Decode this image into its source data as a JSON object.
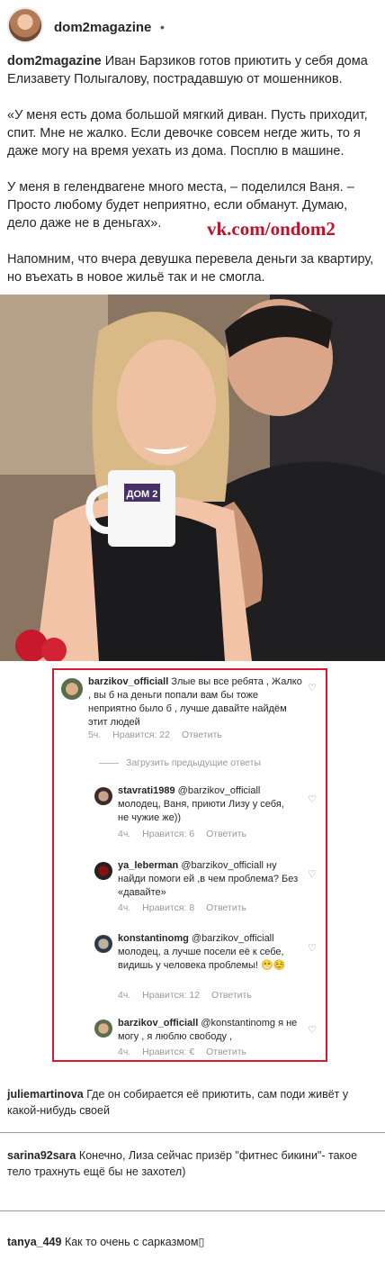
{
  "post": {
    "username": "dom2magazine",
    "dot": "•",
    "caption_user": "dom2magazine",
    "caption_p1": " Иван Барзиков готов приютить у себя дома Елизавету Полыгалову, пострадавшую от мошенников.",
    "caption_p2": "«У меня есть дома большой мягкий диван. Пусть приходит, спит. Мне не жалко. Если девочке совсем негде жить, то я даже могу на время уехать из дома. Посплю в машине.",
    "caption_p3": "У меня в гелендвагене много места, – поделился Ваня. – Просто любому будет неприятно, если обманут. Думаю, дело даже не в деньгах».",
    "caption_p4": "Напомним, что вчера девушка перевела деньги за квартиру, но въехать в новое жильё так и не смогла.",
    "watermark": "vk.com/ondom2",
    "mug_logo": "ДОМ 2"
  },
  "screenshot": {
    "main": {
      "user": "barzikov_officiall",
      "text": " Злые вы все ребята , Жалко , вы б на деньги попали вам бы тоже неприятно было б , лучше давайте найдём этит людей",
      "time": "5ч.",
      "likes": "Нравится: 22",
      "reply": "Ответить"
    },
    "load_more": "Загрузить предыдущие ответы",
    "replies": [
      {
        "user": "stavrati1989",
        "text": " @barzikov_officiall молодец, Ваня, приюти Лизу у себя, не чужие же))",
        "time": "4ч.",
        "likes": "Нравится: 6",
        "reply": "Ответить"
      },
      {
        "user": "ya_leberman",
        "text": " @barzikov_officiall ну найди помоги ей ,в чем проблема? Без «давайте»",
        "time": "4ч.",
        "likes": "Нравится: 8",
        "reply": "Ответить"
      },
      {
        "user": "konstantinomg",
        "text": " @barzikov_officiall молодец, а лучше посели её к себе, видишь у человека проблемы! 😁☺️",
        "time": "4ч.",
        "likes": "Нравится: 12",
        "reply": "Ответить"
      },
      {
        "user": "barzikov_officiall",
        "text": " @konstantinomg я не могу , я люблю свободу ,",
        "time": "4ч.",
        "likes": "Нравится: €",
        "reply": "Ответить"
      }
    ]
  },
  "comments": [
    {
      "user": "juliemartinova",
      "text": " Где он собирается её приютить, сам поди живёт у какой-нибудь своей"
    },
    {
      "user": "sarina92sara",
      "text": " Конечно, Лиза сейчас призёр \"фитнес бикини\"- такое тело трахнуть ещё бы не захотел)"
    },
    {
      "user": "tanya_449",
      "text": " Как то очень с сарказмом▯"
    }
  ]
}
